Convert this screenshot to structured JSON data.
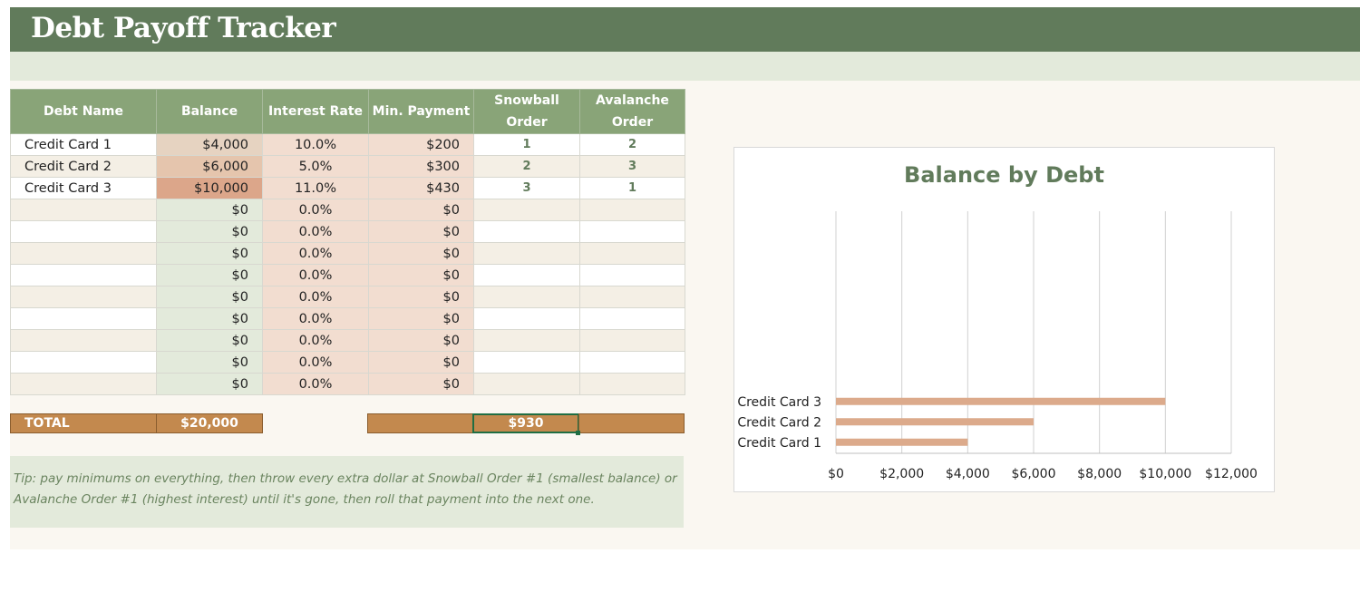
{
  "title": "Debt Payoff Tracker",
  "table": {
    "headers": {
      "name": "Debt Name",
      "balance": "Balance",
      "rate": "Interest Rate",
      "min": "Min. Payment",
      "snowball1": "Snowball",
      "snowball2": "Order",
      "avalanche1": "Avalanche",
      "avalanche2": "Order"
    },
    "rows": [
      {
        "name": "Credit Card 1",
        "balance": "$4,000",
        "rate": "10.0%",
        "min": "$200",
        "snowball": "1",
        "avalanche": "2"
      },
      {
        "name": "Credit Card 2",
        "balance": "$6,000",
        "rate": "5.0%",
        "min": "$300",
        "snowball": "2",
        "avalanche": "3"
      },
      {
        "name": "Credit Card 3",
        "balance": "$10,000",
        "rate": "11.0%",
        "min": "$430",
        "snowball": "3",
        "avalanche": "1"
      },
      {
        "name": "",
        "balance": "$0",
        "rate": "0.0%",
        "min": "$0",
        "snowball": "",
        "avalanche": ""
      },
      {
        "name": "",
        "balance": "$0",
        "rate": "0.0%",
        "min": "$0",
        "snowball": "",
        "avalanche": ""
      },
      {
        "name": "",
        "balance": "$0",
        "rate": "0.0%",
        "min": "$0",
        "snowball": "",
        "avalanche": ""
      },
      {
        "name": "",
        "balance": "$0",
        "rate": "0.0%",
        "min": "$0",
        "snowball": "",
        "avalanche": ""
      },
      {
        "name": "",
        "balance": "$0",
        "rate": "0.0%",
        "min": "$0",
        "snowball": "",
        "avalanche": ""
      },
      {
        "name": "",
        "balance": "$0",
        "rate": "0.0%",
        "min": "$0",
        "snowball": "",
        "avalanche": ""
      },
      {
        "name": "",
        "balance": "$0",
        "rate": "0.0%",
        "min": "$0",
        "snowball": "",
        "avalanche": ""
      },
      {
        "name": "",
        "balance": "$0",
        "rate": "0.0%",
        "min": "$0",
        "snowball": "",
        "avalanche": ""
      },
      {
        "name": "",
        "balance": "$0",
        "rate": "0.0%",
        "min": "$0",
        "snowball": "",
        "avalanche": ""
      }
    ]
  },
  "totals": {
    "label": "TOTAL",
    "balance": "$20,000",
    "min_payment": "$930"
  },
  "tip": "Tip: pay minimums on everything, then throw every extra dollar at Snowball Order #1 (smallest balance) or Avalanche Order #1 (highest interest) until it's gone, then roll that payment into the next one.",
  "colors": {
    "header_green": "#617b5b",
    "table_header": "#89a478",
    "total_brown": "#c3894e",
    "bar_color": "#dcaa8b"
  },
  "chart_data": {
    "type": "bar",
    "orientation": "horizontal",
    "title": "Balance by Debt",
    "categories": [
      "Credit Card 1",
      "Credit Card 2",
      "Credit Card 3"
    ],
    "values": [
      4000,
      6000,
      10000
    ],
    "xlim": [
      0,
      12000
    ],
    "ticks": [
      0,
      2000,
      4000,
      6000,
      8000,
      10000,
      12000
    ],
    "tick_labels": [
      "$0",
      "$2,000",
      "$4,000",
      "$6,000",
      "$8,000",
      "$10,000",
      "$12,000"
    ],
    "grid": true,
    "legend": "none"
  }
}
